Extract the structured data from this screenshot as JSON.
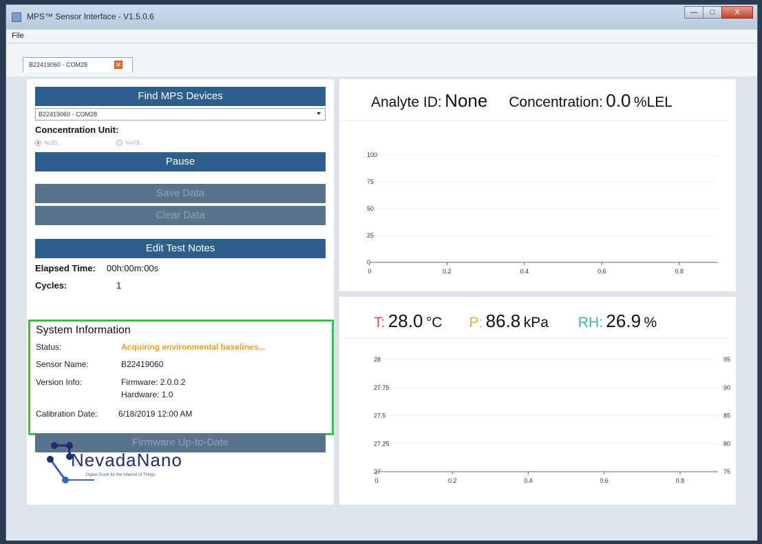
{
  "window": {
    "title": "MPS™ Sensor Interface - V1.5.0.6",
    "controls": {
      "minimize": "—",
      "maximize": "□",
      "close": "X"
    }
  },
  "menu": {
    "file": "File"
  },
  "tab": {
    "label": "B22419060 - COM28",
    "close": "✕"
  },
  "left": {
    "find_button": "Find MPS Devices",
    "device_select": "B22419060 - COM28",
    "concentration_unit_label": "Concentration Unit:",
    "units": [
      {
        "label": "%LEL",
        "checked": true
      },
      {
        "label": "%VOL",
        "checked": false
      }
    ],
    "pause_button": "Pause",
    "save_button": "Save Data",
    "clear_button": "Clear Data",
    "edit_notes_button": "Edit Test Notes",
    "elapsed_label": "Elapsed Time:",
    "elapsed_value": "00h:00m:00s",
    "cycles_label": "Cycles:",
    "cycles_value": "1",
    "firmware_button": "Firmware Up-to-Date",
    "logo": {
      "name": "NevadaNano",
      "tagline": "Digital Scent for the Internet of Things"
    }
  },
  "system_info": {
    "title": "System Information",
    "status_label": "Status:",
    "status_value": "Acquiring environmental baselines...",
    "sensor_name_label": "Sensor Name:",
    "sensor_name_value": "B22419060",
    "version_label": "Version Info:",
    "firmware_value": "Firmware: 2.0.0.2",
    "hardware_value": "Hardware: 1.0",
    "calibration_label": "Calibration Date:",
    "calibration_value": "6/18/2019 12:00 AM"
  },
  "top_chart": {
    "analyte_label": "Analyte ID:",
    "analyte_value": "None",
    "concentration_label": "Concentration:",
    "concentration_value": "0.0",
    "concentration_unit": "%LEL"
  },
  "env": {
    "t_label": "T:",
    "t_value": "28.0",
    "t_unit": "°C",
    "p_label": "P:",
    "p_value": "86.8",
    "p_unit": "kPa",
    "rh_label": "RH:",
    "rh_value": "26.9",
    "rh_unit": "%"
  },
  "colors": {
    "button_blue": "#2d5e8c",
    "status_orange": "#f0a020",
    "t_red": "#e0493a",
    "p_orange": "#f2a65a",
    "rh_teal": "#3fb6b0",
    "highlight_green": "#3dbd4a"
  },
  "chart_data": [
    {
      "type": "line",
      "title": "",
      "xlabel": "",
      "ylabel": "",
      "xlim": [
        0,
        0.9
      ],
      "ylim": [
        0,
        100
      ],
      "x_ticks": [
        0,
        0.2,
        0.4,
        0.6,
        0.8
      ],
      "y_ticks": [
        0,
        25,
        50,
        75,
        100
      ],
      "series": []
    },
    {
      "type": "line",
      "title": "",
      "xlabel": "",
      "ylabel": "",
      "xlim": [
        0,
        0.9
      ],
      "ylim": [
        27,
        28
      ],
      "y2lim": [
        75,
        95
      ],
      "x_ticks": [
        0,
        0.2,
        0.4,
        0.6,
        0.8
      ],
      "y_ticks": [
        27,
        27.25,
        27.5,
        27.75,
        28
      ],
      "y2_ticks": [
        75,
        80,
        85,
        90,
        95
      ],
      "series": []
    }
  ]
}
